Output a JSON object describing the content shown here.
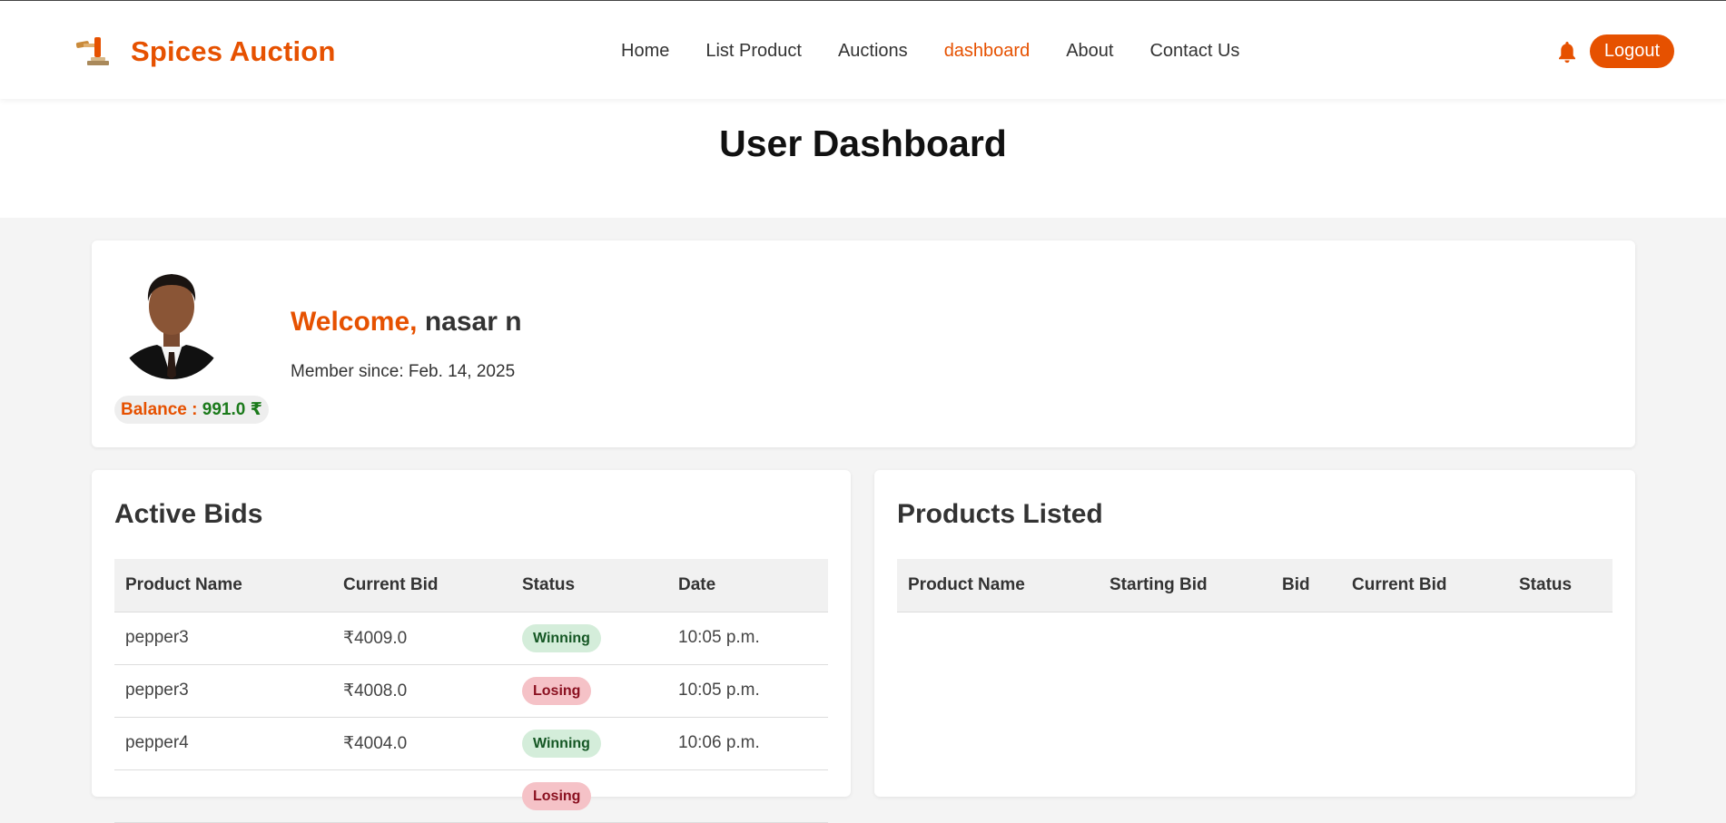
{
  "navbar": {
    "brand_name": "Spices Auction",
    "logo_icon": "gavel-icon",
    "links": [
      "Home",
      "List Product",
      "Auctions",
      "dashboard",
      "About",
      "Contact Us"
    ],
    "active_link": "dashboard",
    "logout_label": "Logout",
    "bell_icon": "bell-icon",
    "accent_color": "#e65100"
  },
  "page": {
    "title": "User Dashboard"
  },
  "profile": {
    "welcome_label": "Welcome,",
    "username": "nasar n",
    "member_since": "Member since: Feb. 14, 2025",
    "balance_label": "Balance :",
    "balance_value": "991.0 ₹"
  },
  "active_bids": {
    "title": "Active Bids",
    "columns": [
      "Product Name",
      "Current Bid",
      "Status",
      "Date"
    ],
    "rows": [
      {
        "product": "pepper3",
        "bid": "₹4009.0",
        "status": "Winning",
        "date": "10:05 p.m."
      },
      {
        "product": "pepper3",
        "bid": "₹4008.0",
        "status": "Losing",
        "date": "10:05 p.m."
      },
      {
        "product": "pepper4",
        "bid": "₹4004.0",
        "status": "Winning",
        "date": "10:06 p.m."
      },
      {
        "product": "",
        "bid": "",
        "status": "Losing",
        "date": ""
      }
    ]
  },
  "products_listed": {
    "title": "Products Listed",
    "columns": [
      "Product Name",
      "Starting Bid",
      "Bid",
      "Current Bid",
      "Status"
    ]
  }
}
